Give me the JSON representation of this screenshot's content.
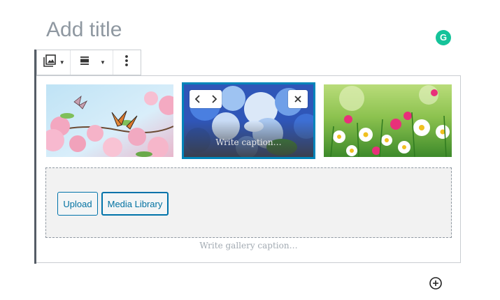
{
  "editor": {
    "title_placeholder": "Add title",
    "grammarly_badge": "G"
  },
  "toolbar": {
    "buttons": [
      {
        "name": "change-block-type",
        "icon": "gallery-icon"
      },
      {
        "name": "change-alignment",
        "icon": "align-center-icon"
      },
      {
        "name": "more-options",
        "icon": "more-vertical-icon"
      }
    ]
  },
  "gallery": {
    "images": [
      {
        "alt": "pink blossoms with butterflies"
      },
      {
        "alt": "blue flowers",
        "selected": true,
        "caption_placeholder": "Write caption…"
      },
      {
        "alt": "daisies in grass"
      }
    ],
    "upload_label": "Upload",
    "media_library_label": "Media Library",
    "caption_placeholder": "Write gallery caption…"
  },
  "colors": {
    "accent": "#0085ba",
    "button_text": "#0071a1",
    "title_placeholder": "#8f98a1",
    "grammarly": "#15c39a"
  }
}
